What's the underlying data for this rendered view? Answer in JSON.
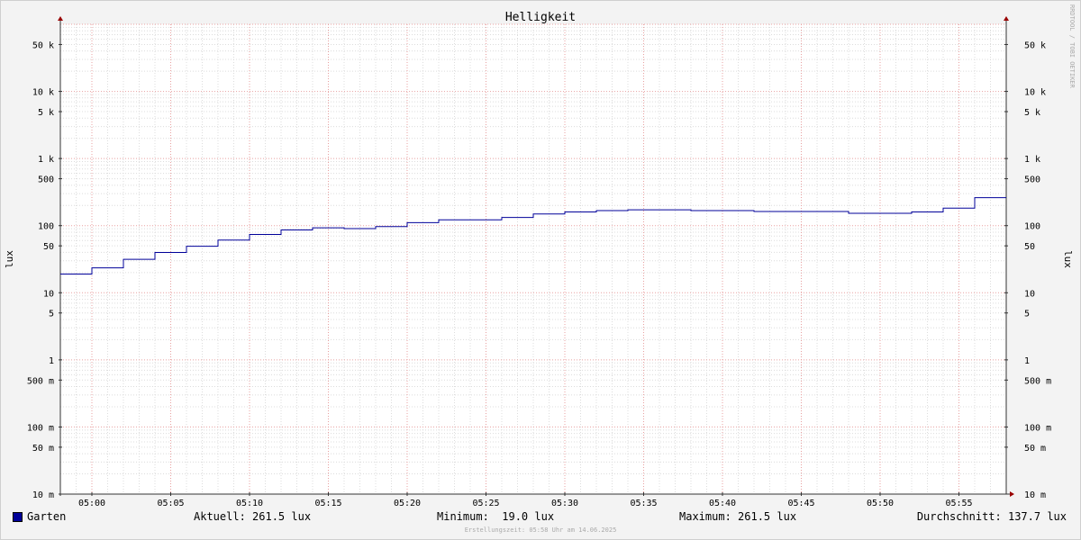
{
  "chart_data": {
    "type": "line",
    "title": "Helligkeit",
    "ylabel": "lux",
    "y_scale": "log",
    "ylim": [
      0.01,
      100000
    ],
    "y_ticks": [
      {
        "value": 50000,
        "label": "50 k"
      },
      {
        "value": 10000,
        "label": "10 k"
      },
      {
        "value": 5000,
        "label": "5 k"
      },
      {
        "value": 1000,
        "label": "1 k"
      },
      {
        "value": 500,
        "label": "500"
      },
      {
        "value": 100,
        "label": "100"
      },
      {
        "value": 50,
        "label": "50"
      },
      {
        "value": 10,
        "label": "10"
      },
      {
        "value": 5,
        "label": "5"
      },
      {
        "value": 1,
        "label": "1"
      },
      {
        "value": 0.5,
        "label": "500 m"
      },
      {
        "value": 0.1,
        "label": "100 m"
      },
      {
        "value": 0.05,
        "label": "50 m"
      },
      {
        "value": 0.01,
        "label": "10 m"
      }
    ],
    "xlim": [
      "04:58",
      "05:58"
    ],
    "x_ticks": [
      "05:00",
      "05:05",
      "05:10",
      "05:15",
      "05:20",
      "05:25",
      "05:30",
      "05:35",
      "05:40",
      "05:45",
      "05:50",
      "05:55"
    ],
    "grid": true,
    "series": [
      {
        "name": "Garten",
        "color": "#000099",
        "step": true,
        "points": [
          [
            "04:58",
            19.0
          ],
          [
            "05:00",
            23.5
          ],
          [
            "05:02",
            31.5
          ],
          [
            "05:04",
            39.8
          ],
          [
            "05:06",
            49.2
          ],
          [
            "05:08",
            61.0
          ],
          [
            "05:10",
            74.0
          ],
          [
            "05:12",
            86.4
          ],
          [
            "05:14",
            93.0
          ],
          [
            "05:16",
            90.4
          ],
          [
            "05:18",
            97.0
          ],
          [
            "05:20",
            111.0
          ],
          [
            "05:22",
            122.0
          ],
          [
            "05:25",
            122.0
          ],
          [
            "05:26",
            132.5
          ],
          [
            "05:28",
            149.4
          ],
          [
            "05:30",
            160.0
          ],
          [
            "05:32",
            167.5
          ],
          [
            "05:34",
            172.2
          ],
          [
            "05:38",
            167.5
          ],
          [
            "05:42",
            162.2
          ],
          [
            "05:48",
            153.0
          ],
          [
            "05:52",
            160.0
          ],
          [
            "05:54",
            182.2
          ],
          [
            "05:56",
            261.5
          ],
          [
            "05:58",
            261.5
          ]
        ]
      }
    ]
  },
  "watermark": "RRDTOOL / TOBI OETIKER",
  "legend": {
    "series_name": "Garten",
    "series_color": "#000099",
    "current": "Aktuell: 261.5 lux",
    "minimum": "Minimum:  19.0 lux",
    "maximum": "Maximum: 261.5 lux",
    "average": "Durchschnitt: 137.7 lux"
  },
  "footnote": "Erstellungszeit: 05:58 Uhr am 14.06.2025"
}
